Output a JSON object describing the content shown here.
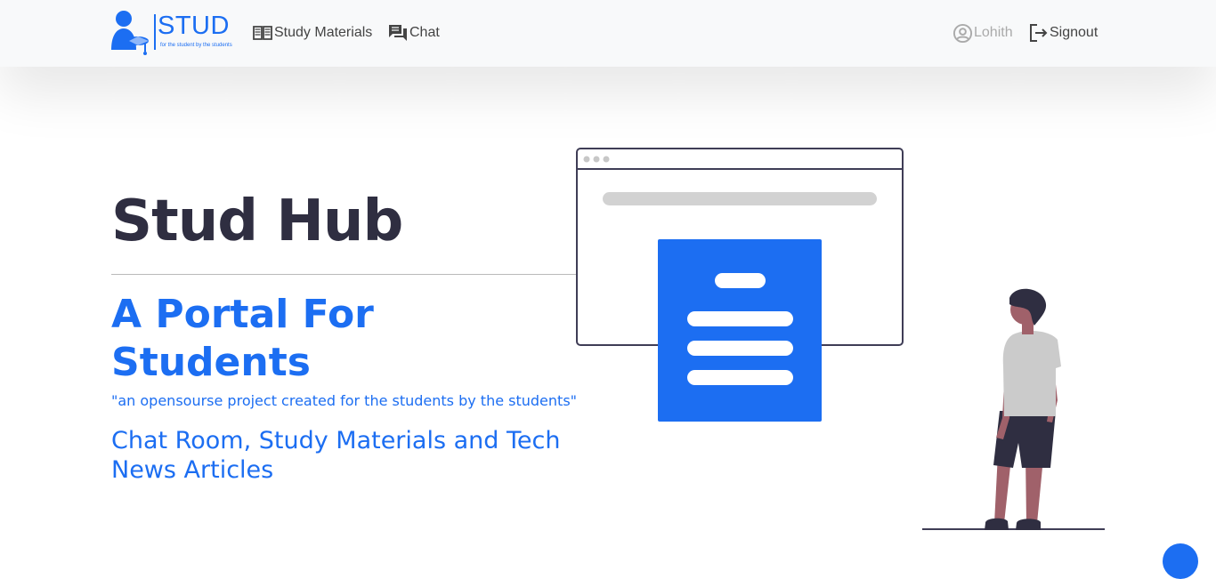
{
  "navbar": {
    "logo_text": "STUD",
    "logo_tagline": "for the student by the students",
    "links": [
      {
        "label": "Study Materials",
        "icon": "book-icon"
      },
      {
        "label": "Chat",
        "icon": "chat-icon"
      }
    ],
    "user": {
      "label": "Lohith",
      "icon": "user-circle-icon"
    },
    "signout": {
      "label": "Signout",
      "icon": "logout-icon"
    }
  },
  "hero": {
    "title": "Stud Hub",
    "subtitle": "A Portal For Students",
    "quote": "\"an opensourse project created for the students by the students\"",
    "features": "Chat Room, Study Materials and Tech News Articles"
  },
  "colors": {
    "accent": "#1c6ef2",
    "heading": "#2f2e41",
    "navbar_bg": "#f8f9fa"
  }
}
